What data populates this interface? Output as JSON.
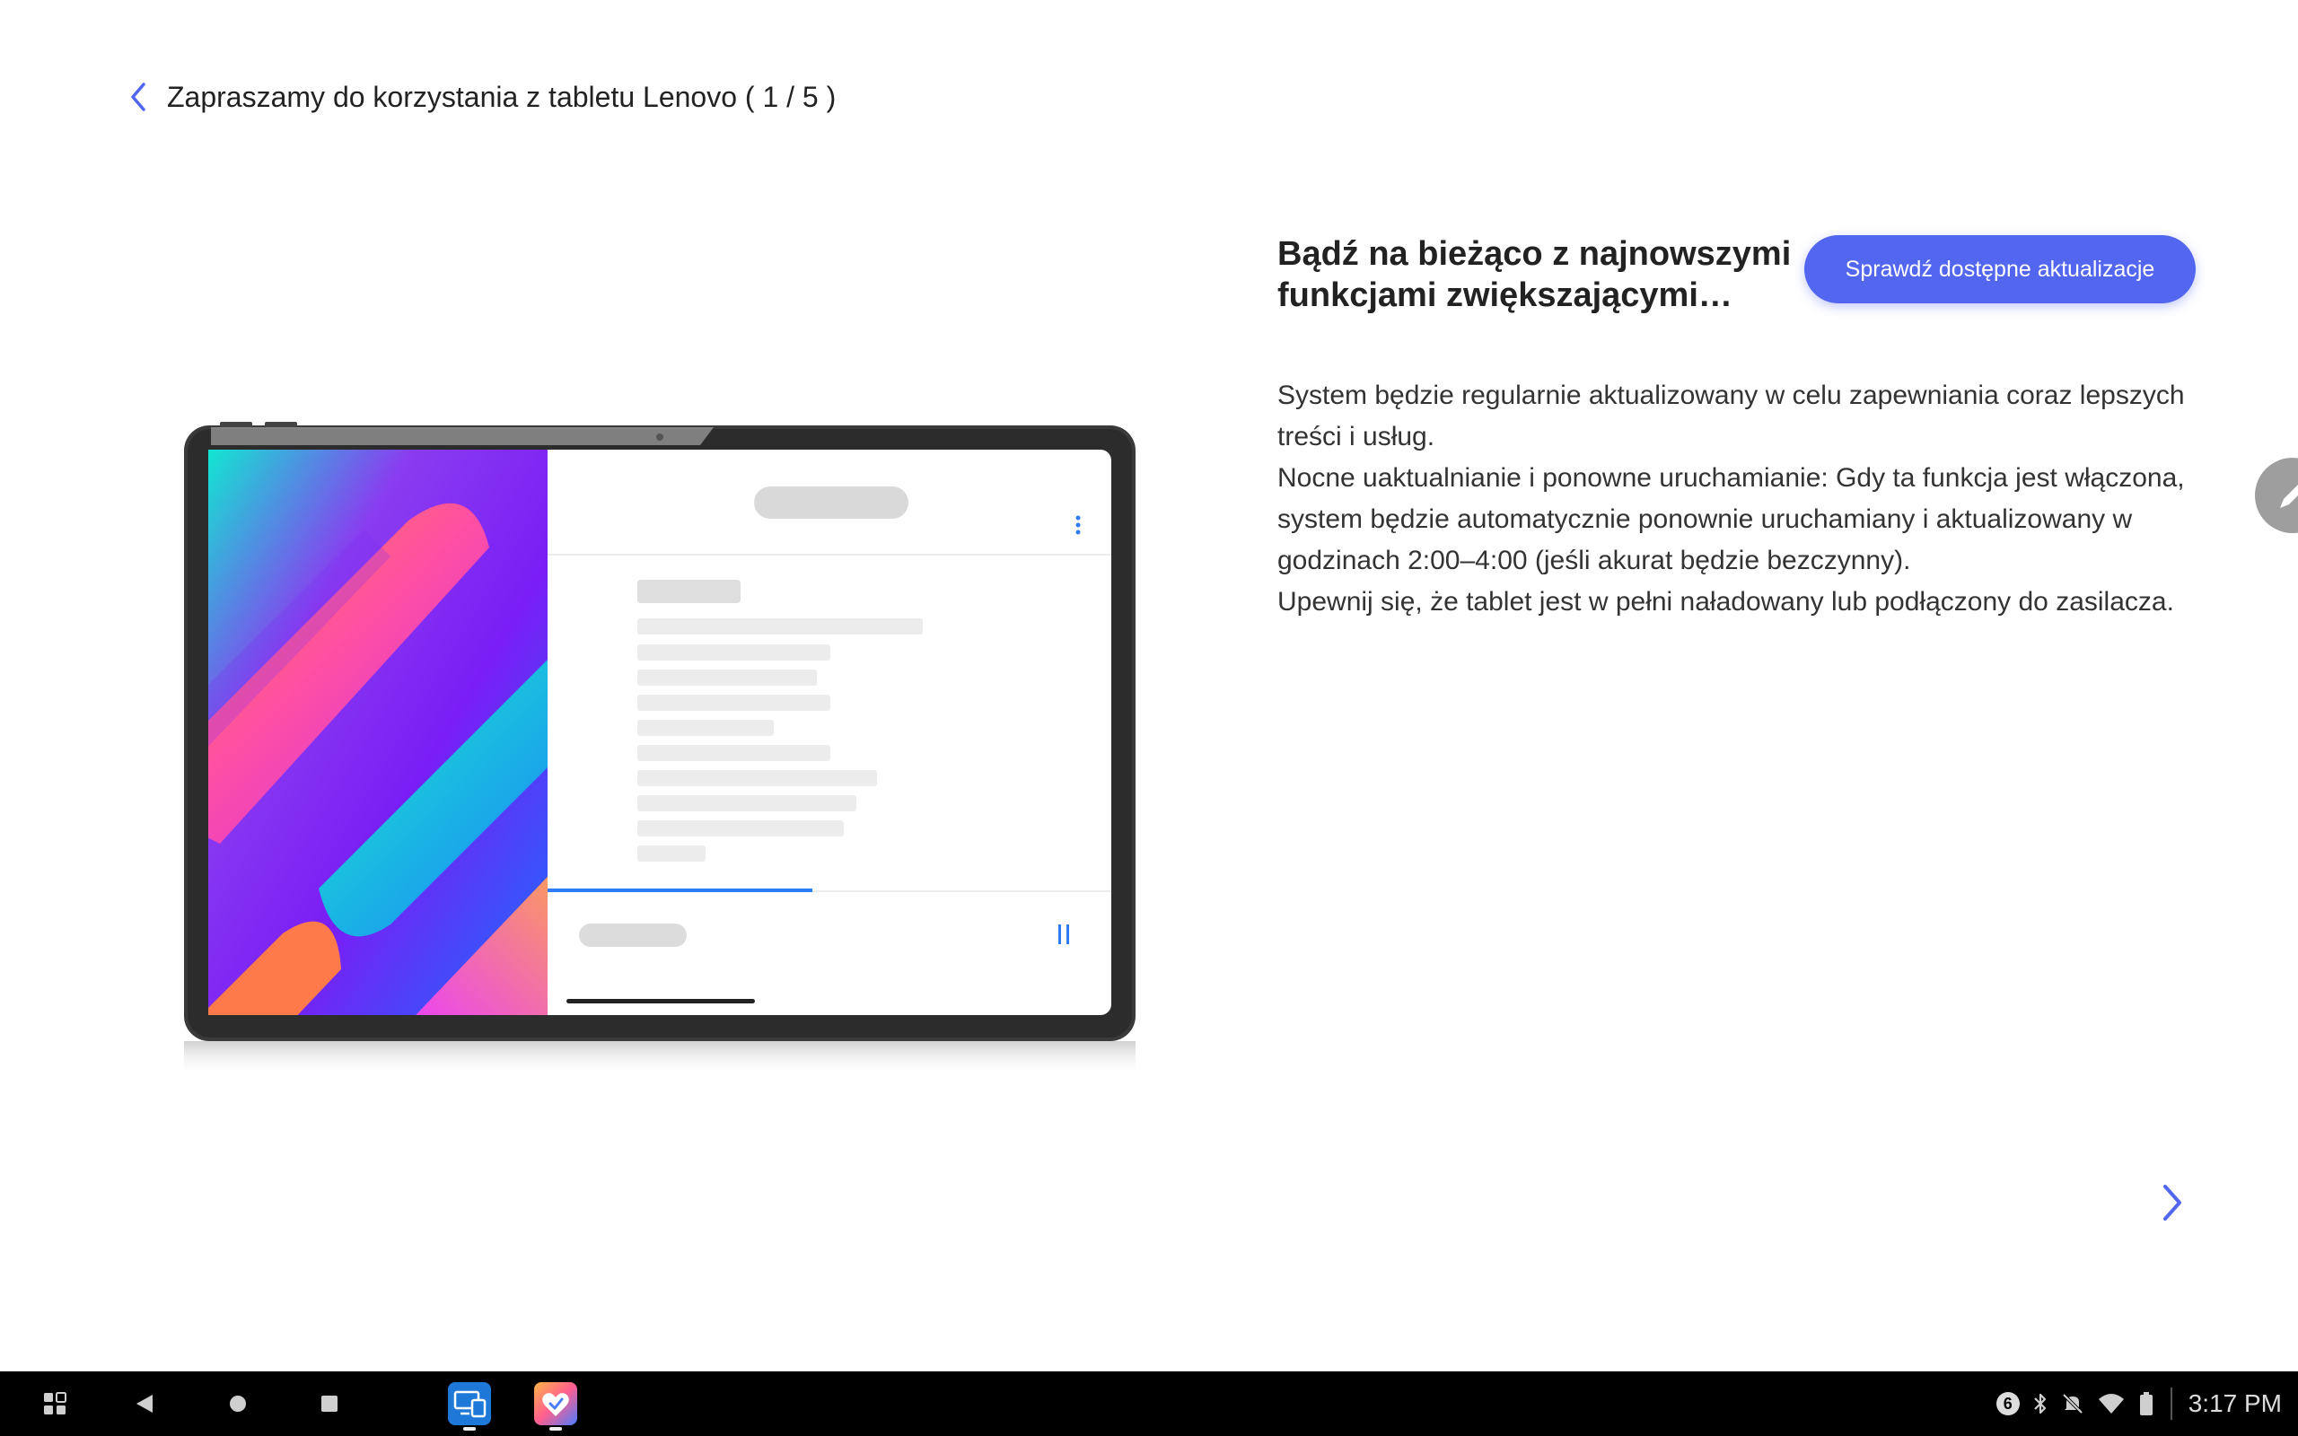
{
  "header": {
    "title": "Zapraszamy do korzystania z tabletu Lenovo ( 1 / 5 )"
  },
  "main": {
    "heading_line1": "Bądź na bieżąco z najnowszymi",
    "heading_line2": "funkcjami zwiększającymi…",
    "check_button": "Sprawdź dostępne aktualizacje",
    "paragraphs": [
      "System będzie regularnie aktualizowany w celu zapewniania coraz lepszych treści i usług.",
      "Nocne uaktualnianie i ponowne uruchamianie: Gdy ta funkcja jest włączona, system będzie automatycznie ponownie uruchamiany i aktualizowany w godzinach 2:00–4:00 (jeśli akurat będzie bezczynny).",
      "Upewnij się, że tablet jest w pełni naładowany lub podłączony do zasilacza."
    ]
  },
  "illustration": {
    "progress": 0.47
  },
  "taskbar": {
    "notification_count": "6",
    "time": "3:17 PM"
  },
  "colors": {
    "accent": "#5266f0",
    "taskbar": "#000000"
  },
  "icons": [
    "back-arrow-icon",
    "next-arrow-icon",
    "pencil-icon",
    "app-drawer-icon",
    "back-nav-icon",
    "home-nav-icon",
    "recents-nav-icon",
    "bluetooth-icon",
    "mute-icon",
    "wifi-icon",
    "battery-icon"
  ]
}
